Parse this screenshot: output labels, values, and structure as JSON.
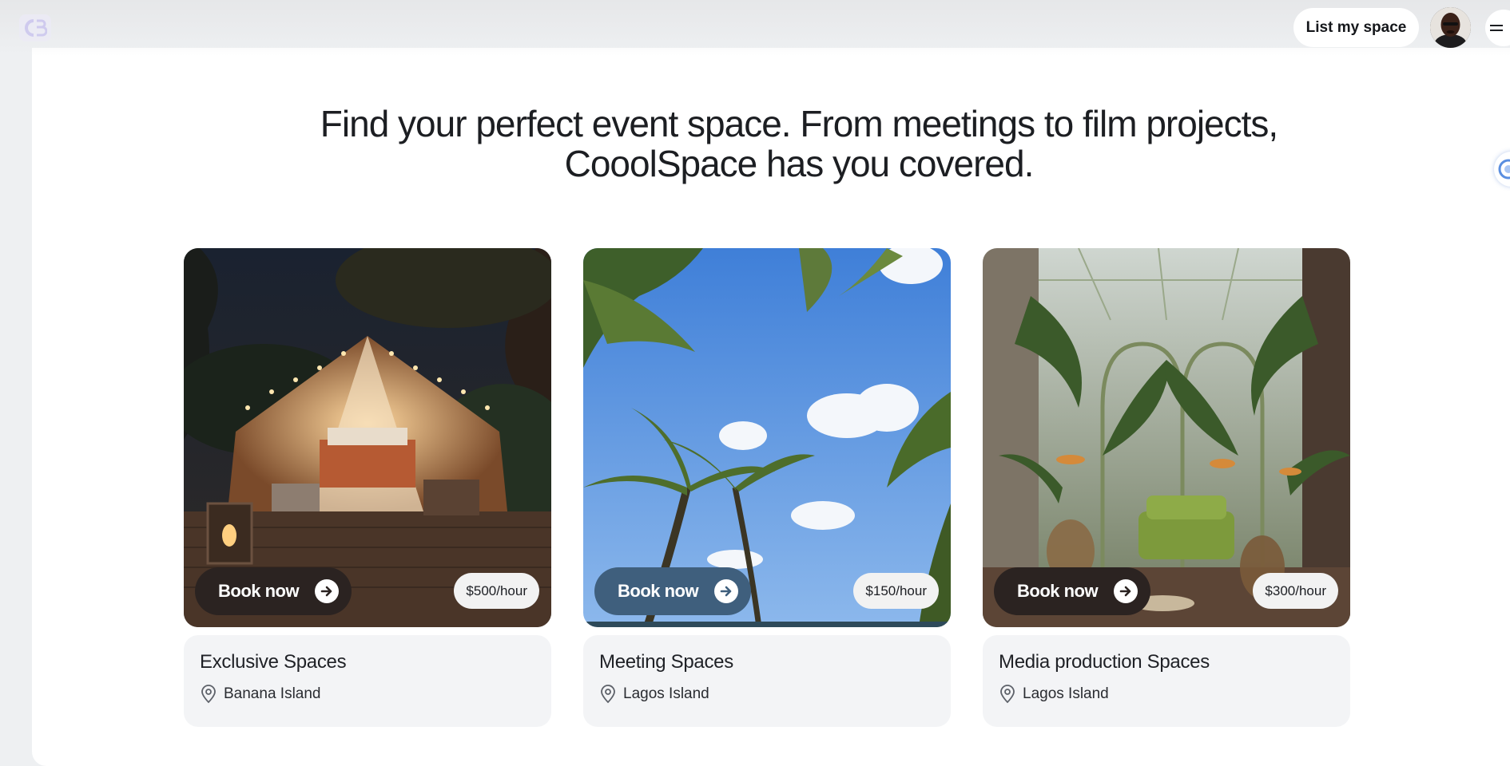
{
  "header": {
    "logo_icon": "coolspace-logo-icon",
    "list_button_label": "List my space",
    "avatar_icon": "user-avatar",
    "menu_icon": "hamburger-menu-icon"
  },
  "hero": {
    "line1": "Find your perfect event space. From meetings to film projects,",
    "line2": "CooolSpace has you covered."
  },
  "cards": [
    {
      "title": "Exclusive Spaces",
      "location": "Banana Island",
      "price": "$500/hour",
      "book_label": "Book now",
      "image": "tent-night-deck"
    },
    {
      "title": "Meeting Spaces",
      "location": "Lagos Island",
      "price": "$150/hour",
      "book_label": "Book now",
      "image": "palm-trees-sky"
    },
    {
      "title": "Media production Spaces",
      "location": "Lagos Island",
      "price": "$300/hour",
      "book_label": "Book now",
      "image": "greenhouse-lounge"
    }
  ],
  "colors": {
    "page_bg": "#eef0f2",
    "card_info_bg": "#f3f4f6",
    "book_btn_dark": "#2b2321",
    "book_btn_blue": "#3f5f7d"
  }
}
